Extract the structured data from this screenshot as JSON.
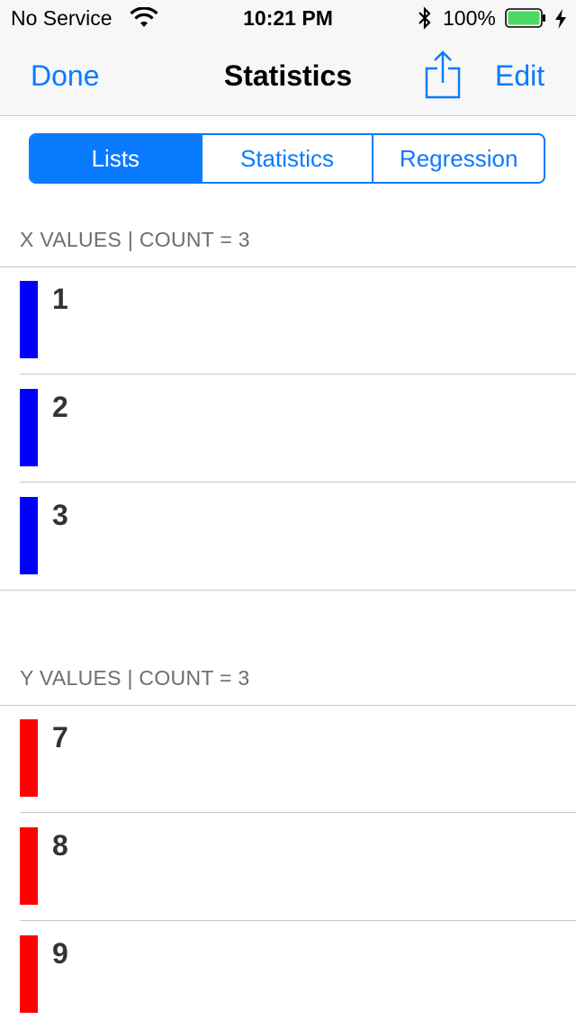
{
  "status_bar": {
    "carrier": "No Service",
    "time": "10:21 PM",
    "battery_percent": "100%",
    "battery_color": "#4cd964"
  },
  "nav": {
    "done_label": "Done",
    "title": "Statistics",
    "share_icon": "share-icon",
    "edit_label": "Edit",
    "accent_color": "#0a7aff"
  },
  "tabs": [
    {
      "label": "Lists",
      "selected": true
    },
    {
      "label": "Statistics",
      "selected": false
    },
    {
      "label": "Regression",
      "selected": false
    }
  ],
  "x_list": {
    "header": "X VALUES | COUNT = 3",
    "color": "#0000ff",
    "values": [
      "1",
      "2",
      "3"
    ]
  },
  "y_list": {
    "header": "Y VALUES | COUNT = 3",
    "color": "#ff0000",
    "values": [
      "7",
      "8",
      "9"
    ]
  }
}
